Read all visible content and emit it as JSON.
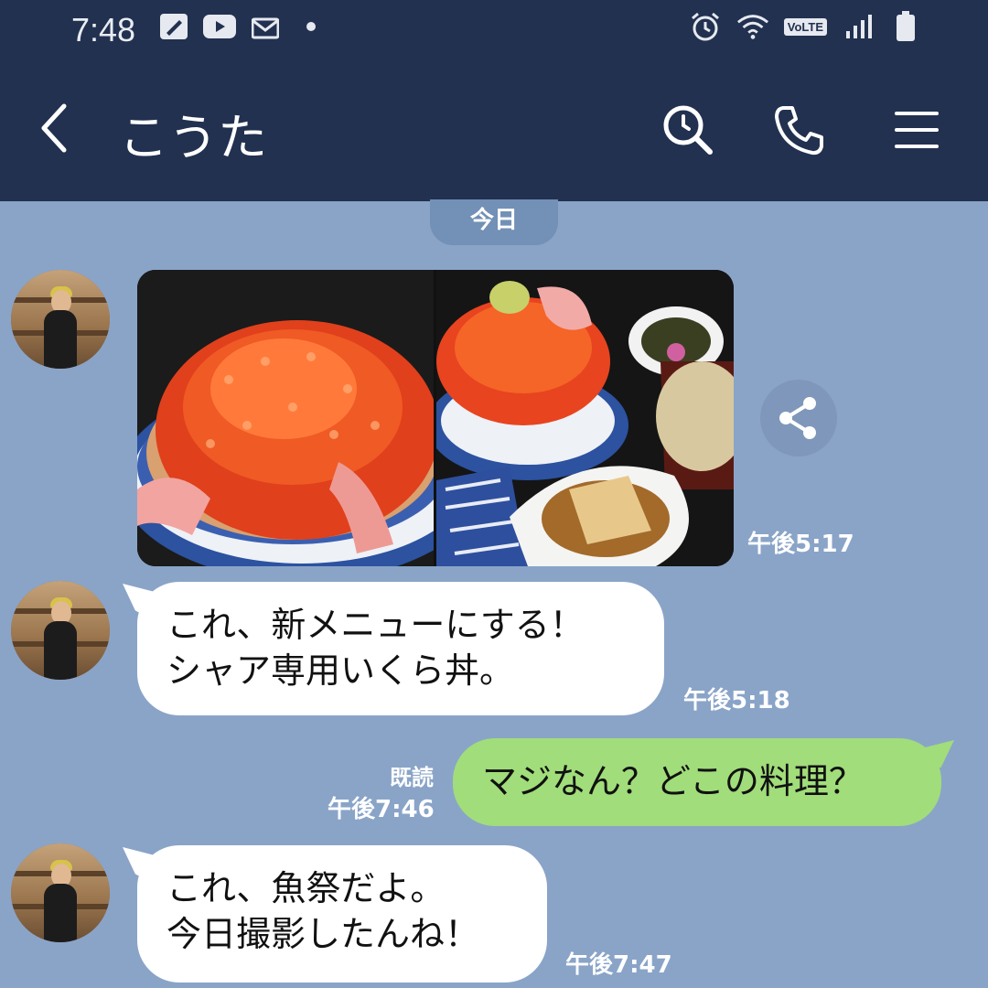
{
  "status_bar": {
    "time": "7:48",
    "icons_left": [
      "edit-notification-icon",
      "youtube-icon",
      "mail-icon",
      "dot-icon"
    ],
    "icons_right": [
      "alarm-icon",
      "wifi-icon",
      "volte-icon",
      "signal-icon",
      "battery-icon"
    ],
    "volte_label": "VoLTE"
  },
  "header": {
    "title": "こうた",
    "background": "#223150"
  },
  "chat": {
    "background": "#8aa4c8",
    "date_label": "今日",
    "messages": [
      {
        "type": "photo",
        "direction": "incoming",
        "time": "午後5:17"
      },
      {
        "type": "text",
        "direction": "incoming",
        "lines": [
          "これ、新メニューにする！",
          "シャア専用いくら丼。"
        ],
        "time": "午後5:18"
      },
      {
        "type": "text",
        "direction": "outgoing",
        "lines": [
          "マジなん？どこの料理？"
        ],
        "read": "既読",
        "time": "午後7:46"
      },
      {
        "type": "text",
        "direction": "incoming",
        "lines": [
          "これ、魚祭だよ。",
          "今日撮影したんね！"
        ],
        "time": "午後7:47"
      }
    ]
  },
  "colors": {
    "outgoing_bubble": "#a1dd7a",
    "incoming_bubble": "#ffffff",
    "date_pill": "#7390b6"
  }
}
